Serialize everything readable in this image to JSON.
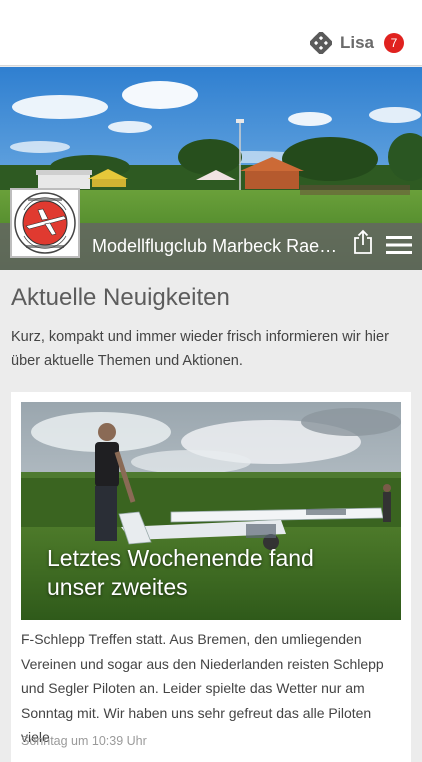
{
  "header": {
    "user_name": "Lisa",
    "notification_count": "7",
    "user_icon": "user-icon"
  },
  "site": {
    "title": "Modellflugclub Marbeck Raesfeld",
    "logo_text": "MODELLFLUGCLUB MARBECK-RAESFELD"
  },
  "news": {
    "title": "Aktuelle Neuigkeiten",
    "intro": "Kurz, kompakt und immer wieder frisch informieren wir hier über aktuelle Themen und Aktionen.",
    "articles": [
      {
        "headline": "Letztes Wochenende fand unser zweites",
        "excerpt": "F-Schlepp Treffen statt. Aus Bremen, den umliegenden Vereinen und sogar aus den Niederlanden reisten Schlepp und Segler Piloten an. Leider spielte das Wetter nur am Sonntag mit. Wir haben uns sehr gefreut das alle Piloten viele",
        "date": "Sonntag um 10:39 Uhr"
      }
    ]
  },
  "colors": {
    "badge": "#e0221f",
    "site_bar": "#646464",
    "background": "#ececec"
  }
}
